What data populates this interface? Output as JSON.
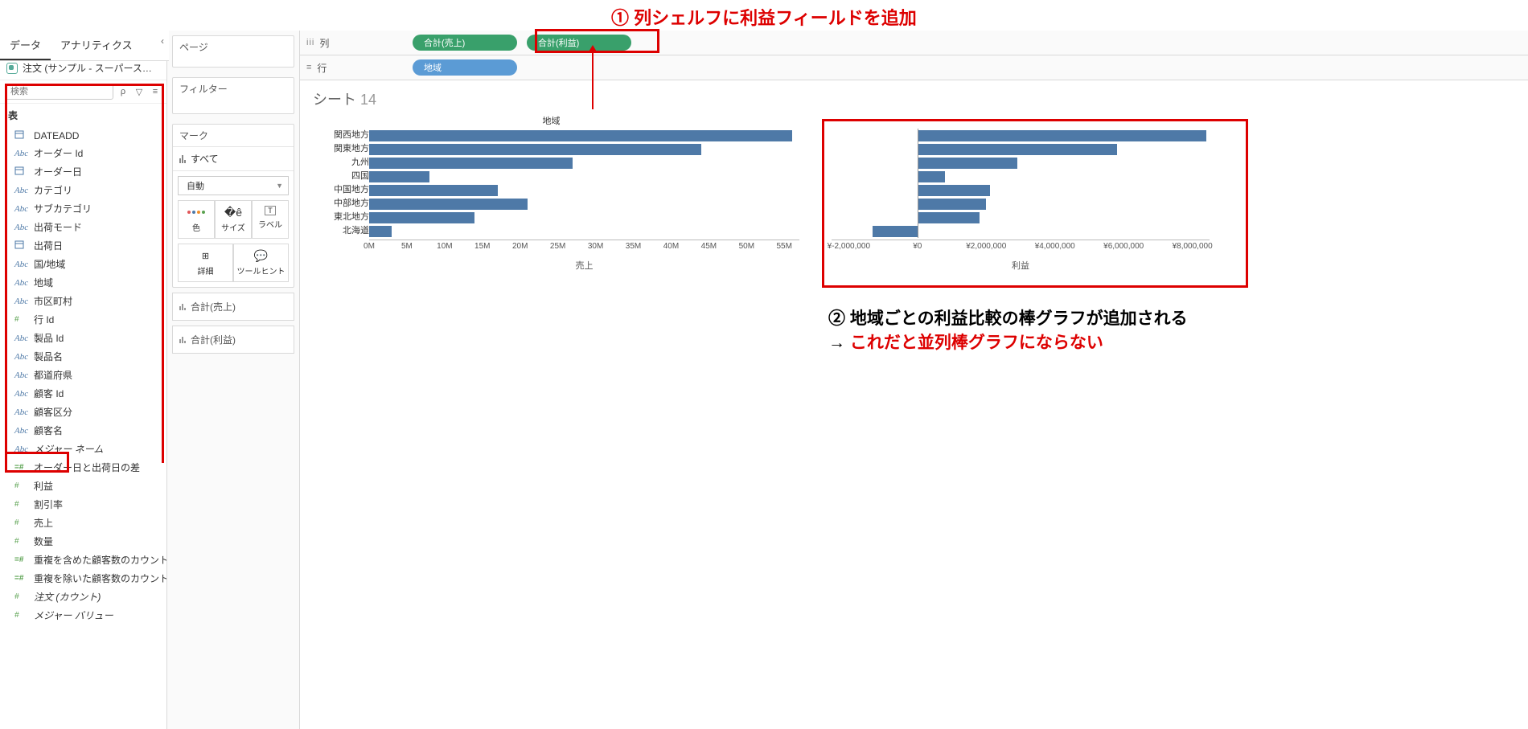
{
  "annotations": {
    "a1_num": "①",
    "a1_text": "列シェルフに利益フィールドを追加",
    "a2_num": "②",
    "a2_text": "地域ごとの利益比較の棒グラフが追加される",
    "a3_arrow": "→",
    "a3_text": "これだと並列棒グラフにならない"
  },
  "tabs": {
    "data": "データ",
    "analytics": "アナリティクス"
  },
  "datasource": "注文 (サンプル - スーパース…",
  "search_placeholder": "検索",
  "table_header": "表",
  "fields": [
    {
      "icon": "date",
      "label": "DATEADD"
    },
    {
      "icon": "abc",
      "label": "オーダー Id"
    },
    {
      "icon": "date",
      "label": "オーダー日"
    },
    {
      "icon": "abc",
      "label": "カテゴリ"
    },
    {
      "icon": "abc",
      "label": "サブカテゴリ"
    },
    {
      "icon": "abc",
      "label": "出荷モード"
    },
    {
      "icon": "date",
      "label": "出荷日"
    },
    {
      "icon": "abc",
      "label": "国/地域"
    },
    {
      "icon": "abc",
      "label": "地域"
    },
    {
      "icon": "abc",
      "label": "市区町村"
    },
    {
      "icon": "hash",
      "label": "行 Id"
    },
    {
      "icon": "abc",
      "label": "製品 Id"
    },
    {
      "icon": "abc",
      "label": "製品名"
    },
    {
      "icon": "abc",
      "label": "都道府県"
    },
    {
      "icon": "abc",
      "label": "顧客 Id"
    },
    {
      "icon": "abc",
      "label": "顧客区分"
    },
    {
      "icon": "abc",
      "label": "顧客名"
    },
    {
      "icon": "abc",
      "label": "メジャー ネーム",
      "italic": true
    },
    {
      "icon": "hashcalc",
      "label": "オーダー日と出荷日の差"
    },
    {
      "icon": "hash",
      "label": "利益"
    },
    {
      "icon": "hash",
      "label": "割引率"
    },
    {
      "icon": "hash",
      "label": "売上"
    },
    {
      "icon": "hash",
      "label": "数量"
    },
    {
      "icon": "hashcalc",
      "label": "重複を含めた顧客数のカウント"
    },
    {
      "icon": "hashcalc",
      "label": "重複を除いた顧客数のカウント"
    },
    {
      "icon": "hash",
      "label": "注文 (カウント)",
      "italic": true
    },
    {
      "icon": "hash",
      "label": "メジャー バリュー",
      "italic": true
    }
  ],
  "cards": {
    "pages": "ページ",
    "filters": "フィルター",
    "marks": "マーク",
    "all": "すべて",
    "auto": "自動",
    "color": "色",
    "size": "サイズ",
    "label": "ラベル",
    "detail": "詳細",
    "tooltip": "ツールヒント",
    "agg1": "合計(売上)",
    "agg2": "合計(利益)"
  },
  "shelves": {
    "columns_label": "列",
    "rows_label": "行",
    "col_pill1": "合計(売上)",
    "col_pill2": "合計(利益)",
    "row_pill1": "地域"
  },
  "sheet": {
    "title_prefix": "シート ",
    "title_num": "14"
  },
  "chart_data": [
    {
      "type": "bar",
      "orientation": "horizontal",
      "header": "地域",
      "categories": [
        "関西地方",
        "関東地方",
        "九州",
        "四国",
        "中国地方",
        "中部地方",
        "東北地方",
        "北海道"
      ],
      "values": [
        56,
        44,
        27,
        8,
        17,
        21,
        14,
        3
      ],
      "xlabel": "売上",
      "xlim": [
        0,
        57
      ],
      "ticks": [
        "0M",
        "5M",
        "10M",
        "15M",
        "20M",
        "25M",
        "30M",
        "35M",
        "40M",
        "45M",
        "50M",
        "55M"
      ]
    },
    {
      "type": "bar",
      "orientation": "horizontal",
      "categories": [
        "関西地方",
        "関東地方",
        "九州",
        "四国",
        "中国地方",
        "中部地方",
        "東北地方",
        "北海道"
      ],
      "values": [
        8400000,
        5800000,
        2900000,
        800000,
        2100000,
        2000000,
        1800000,
        -1300000
      ],
      "xlabel": "利益",
      "xlim": [
        -2500000,
        8500000
      ],
      "ticks": [
        "¥-2,000,000",
        "¥0",
        "¥2,000,000",
        "¥4,000,000",
        "¥6,000,000",
        "¥8,000,000"
      ],
      "tick_vals": [
        -2000000,
        0,
        2000000,
        4000000,
        6000000,
        8000000
      ]
    }
  ]
}
